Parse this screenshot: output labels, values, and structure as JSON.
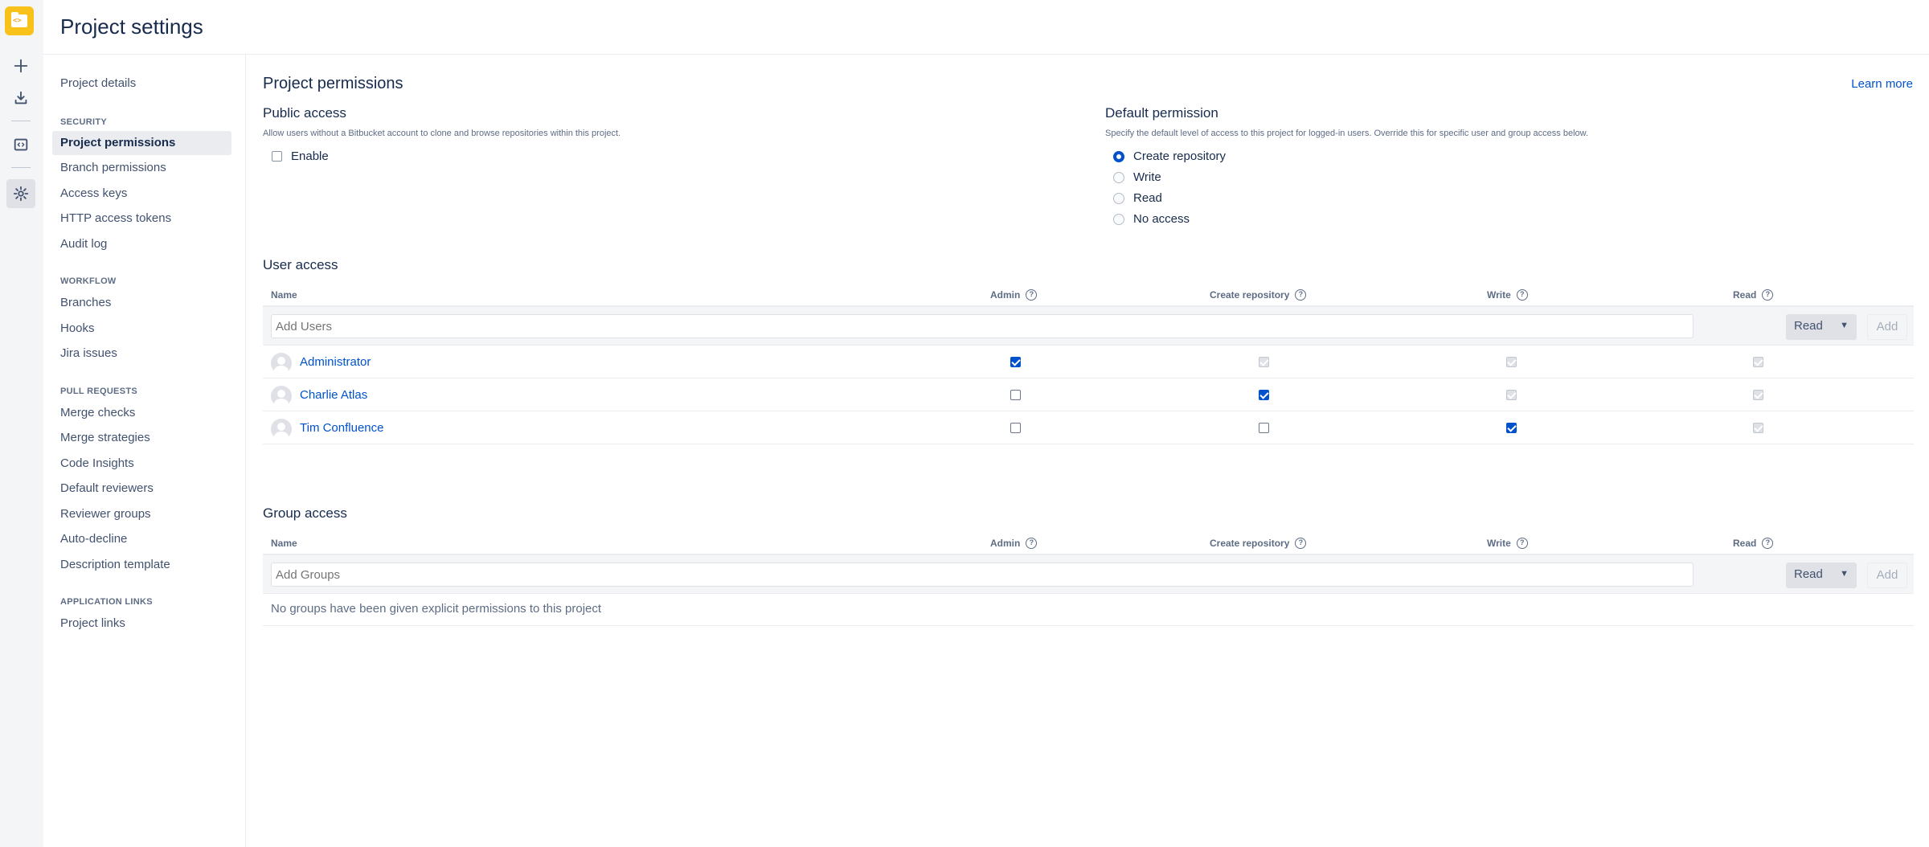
{
  "header": {
    "title": "Project settings"
  },
  "rail": {
    "icons": [
      "project-logo-icon",
      "plus-icon",
      "download-icon",
      "code-icon",
      "gear-icon"
    ]
  },
  "sidebar": {
    "project_details": "Project details",
    "security_heading": "SECURITY",
    "security_items": [
      "Project permissions",
      "Branch permissions",
      "Access keys",
      "HTTP access tokens",
      "Audit log"
    ],
    "workflow_heading": "WORKFLOW",
    "workflow_items": [
      "Branches",
      "Hooks",
      "Jira issues"
    ],
    "pr_heading": "PULL REQUESTS",
    "pr_items": [
      "Merge checks",
      "Merge strategies",
      "Code Insights",
      "Default reviewers",
      "Reviewer groups",
      "Auto-decline",
      "Description template"
    ],
    "links_heading": "APPLICATION LINKS",
    "links_items": [
      "Project links"
    ]
  },
  "main": {
    "title": "Project permissions",
    "learn_more": "Learn more",
    "public_access": {
      "title": "Public access",
      "desc": "Allow users without a Bitbucket account to clone and browse repositories within this project.",
      "enable_label": "Enable",
      "enabled": false
    },
    "default_permission": {
      "title": "Default permission",
      "desc": "Specify the default level of access to this project for logged-in users. Override this for specific user and group access below.",
      "options": [
        "Create repository",
        "Write",
        "Read",
        "No access"
      ],
      "selected": "Create repository"
    },
    "user_access": {
      "title": "User access",
      "columns": [
        "Name",
        "Admin",
        "Create repository",
        "Write",
        "Read"
      ],
      "add_placeholder": "Add Users",
      "select_value": "Read",
      "add_button": "Add",
      "rows": [
        {
          "name": "Administrator",
          "perms": [
            "checked",
            "disabled",
            "disabled",
            "disabled"
          ]
        },
        {
          "name": "Charlie Atlas",
          "perms": [
            "unchecked",
            "checked",
            "disabled",
            "disabled"
          ]
        },
        {
          "name": "Tim Confluence",
          "perms": [
            "unchecked",
            "unchecked",
            "checked",
            "disabled"
          ]
        }
      ]
    },
    "group_access": {
      "title": "Group access",
      "columns": [
        "Name",
        "Admin",
        "Create repository",
        "Write",
        "Read"
      ],
      "add_placeholder": "Add Groups",
      "select_value": "Read",
      "add_button": "Add",
      "empty_message": "No groups have been given explicit permissions to this project"
    }
  }
}
